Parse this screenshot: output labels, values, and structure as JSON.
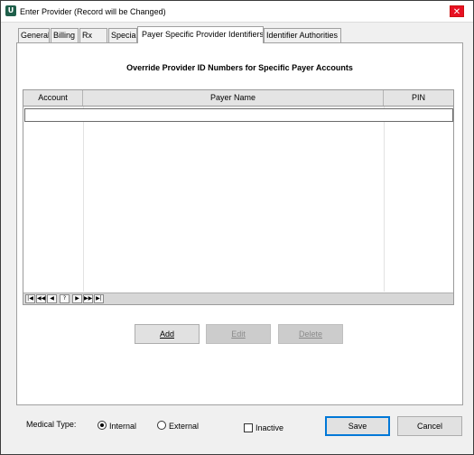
{
  "window": {
    "title": "Enter Provider  (Record will be Changed)",
    "close_glyph": "✕",
    "app_icon_glyph": "U"
  },
  "tabs": [
    {
      "label": "General",
      "active": false
    },
    {
      "label": "Billing",
      "active": false
    },
    {
      "label": "Rx",
      "active": false
    },
    {
      "label": "Special",
      "active": false
    },
    {
      "label": "Payer Specific Provider Identifiers",
      "active": true
    },
    {
      "label": "Identifier Authorities",
      "active": false
    }
  ],
  "panel": {
    "title": "Override Provider ID Numbers for Specific Payer Accounts"
  },
  "grid": {
    "columns": [
      "Account",
      "Payer Name",
      "PIN"
    ],
    "rows": [],
    "navigator": [
      "|◀",
      "◀◀",
      "◀",
      "?",
      "▶",
      "▶▶",
      "▶|"
    ]
  },
  "actions": {
    "add": "Add",
    "edit": "Edit",
    "delete": "Delete"
  },
  "footer": {
    "medical_type_label": "Medical Type:",
    "options": [
      "Internal",
      "External"
    ],
    "selected": "Internal",
    "inactive_label": "Inactive",
    "inactive_checked": false,
    "save": "Save",
    "cancel": "Cancel"
  },
  "colors": {
    "default_button_border": "#0078d7",
    "close_button": "#e81123"
  }
}
